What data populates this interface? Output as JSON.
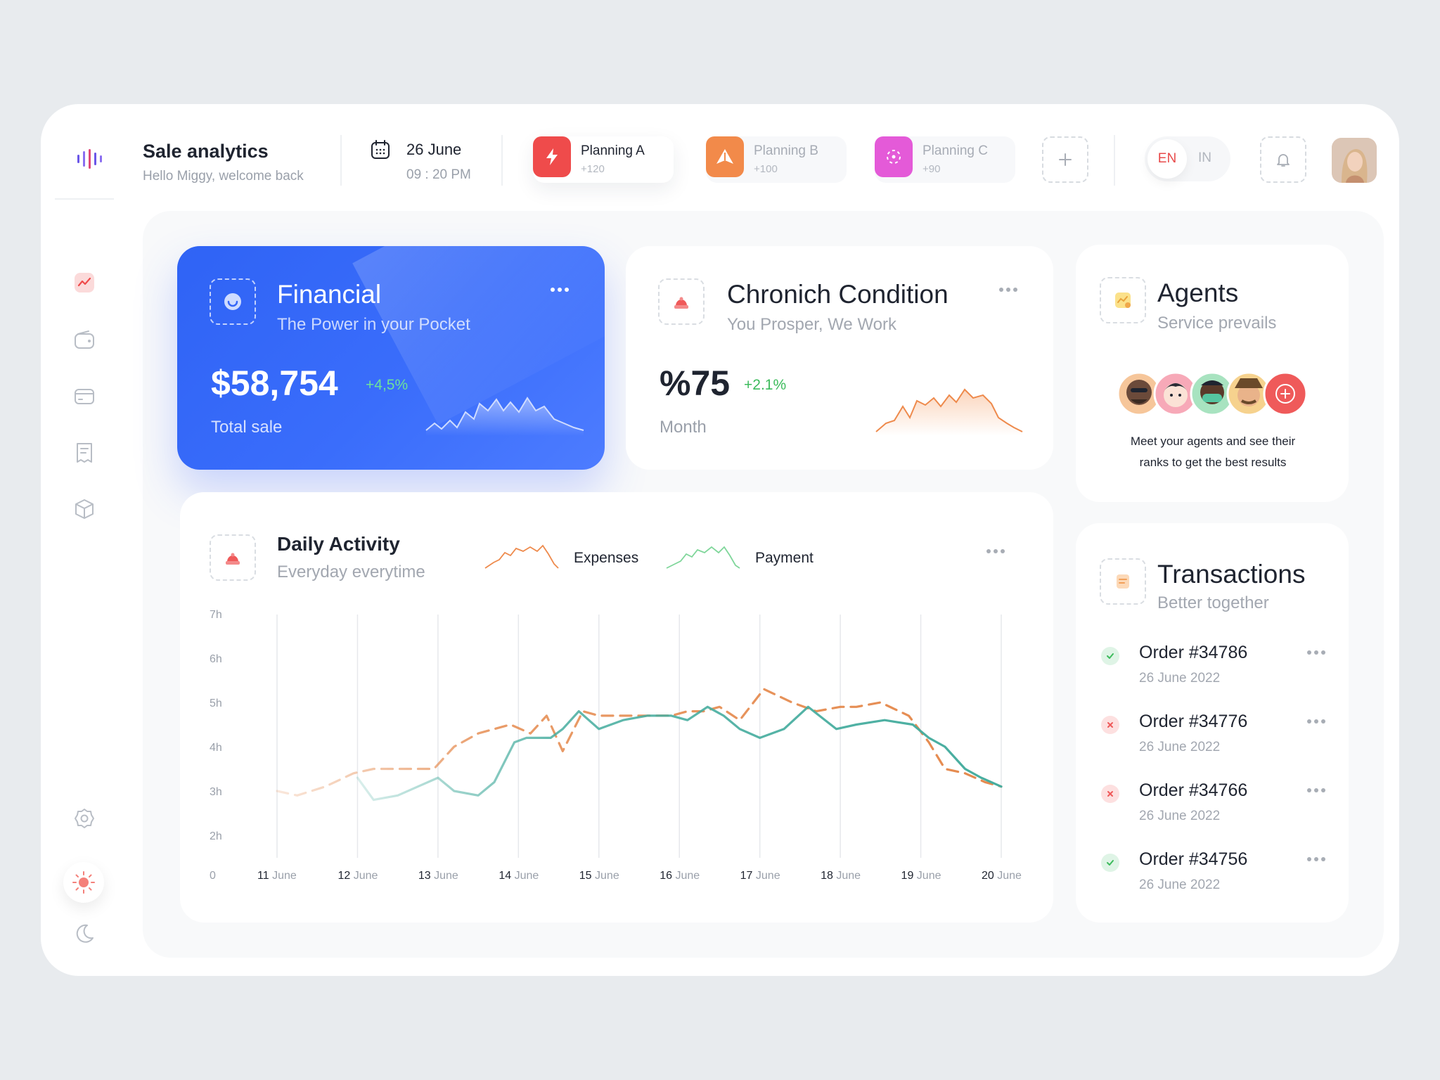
{
  "header": {
    "title": "Sale analytics",
    "subtitle": "Hello Miggy, welcome back",
    "date": "26 June",
    "time": "09 : 20 PM",
    "plans": [
      {
        "name": "Planning A",
        "count": "+120",
        "color": "#ef4b4b",
        "icon": "bolt-icon"
      },
      {
        "name": "Planning B",
        "count": "+100",
        "color": "#f28a4a",
        "icon": "triangle-logo-icon"
      },
      {
        "name": "Planning C",
        "count": "+90",
        "color": "#e45ad8",
        "icon": "scan-icon"
      }
    ],
    "lang_active": "EN",
    "lang_other": "IN"
  },
  "financial": {
    "title": "Financial",
    "subtitle": "The Power in your Pocket",
    "value": "$58,754",
    "delta": "+4,5%",
    "label": "Total sale"
  },
  "chronic": {
    "title": "Chronich Condition",
    "subtitle": "You Prosper, We Work",
    "value": "%75",
    "delta": "+2.1%",
    "label": "Month"
  },
  "agents": {
    "title": "Agents",
    "subtitle": "Service prevails",
    "text_line1": "Meet your agents and see their",
    "text_line2": "ranks to get the best results"
  },
  "daily": {
    "title": "Daily Activity",
    "subtitle": "Everyday everytime",
    "legend_expenses": "Expenses",
    "legend_payment": "Payment"
  },
  "transactions": {
    "title": "Transactions",
    "subtitle": "Better together",
    "items": [
      {
        "order": "Order #34786",
        "date": "26 June 2022",
        "status": "success"
      },
      {
        "order": "Order #34776",
        "date": "26 June 2022",
        "status": "failed"
      },
      {
        "order": "Order #34766",
        "date": "26 June 2022",
        "status": "failed"
      },
      {
        "order": "Order #34756",
        "date": "26 June 2022",
        "status": "success"
      }
    ]
  },
  "colors": {
    "accent_blue": "#3566f8",
    "expenses": "#e58a4e",
    "payment": "#47ad9f",
    "positive": "#3dbb5c",
    "negative": "#ef5a5a"
  },
  "chart_data": {
    "type": "line",
    "y_ticks": [
      "0",
      "2h",
      "3h",
      "4h",
      "5h",
      "6h",
      "7h"
    ],
    "x_ticks": [
      {
        "day": "11",
        "month": "June"
      },
      {
        "day": "12",
        "month": "June"
      },
      {
        "day": "13",
        "month": "June"
      },
      {
        "day": "14",
        "month": "June"
      },
      {
        "day": "15",
        "month": "June"
      },
      {
        "day": "16",
        "month": "June"
      },
      {
        "day": "17",
        "month": "June"
      },
      {
        "day": "18",
        "month": "June"
      },
      {
        "day": "19",
        "month": "June"
      },
      {
        "day": "20",
        "month": "June"
      }
    ],
    "series": [
      {
        "name": "Expenses",
        "style": "dashed",
        "x": [
          11.0,
          11.25,
          11.6,
          11.95,
          12.2,
          12.5,
          12.7,
          12.95,
          13.2,
          13.5,
          13.7,
          13.9,
          14.15,
          14.35,
          14.55,
          14.8,
          15.0,
          15.3,
          15.6,
          15.9,
          16.1,
          16.3,
          16.5,
          16.75,
          17.05,
          17.4,
          17.7,
          18.0,
          18.2,
          18.5,
          18.85,
          19.1,
          19.3,
          19.55,
          19.8,
          20.0
        ],
        "y": [
          3.0,
          2.9,
          3.1,
          3.4,
          3.5,
          3.5,
          3.5,
          3.5,
          4.0,
          4.3,
          4.4,
          4.5,
          4.3,
          4.7,
          3.9,
          4.8,
          4.7,
          4.7,
          4.7,
          4.7,
          4.8,
          4.8,
          4.9,
          4.6,
          5.3,
          5.0,
          4.8,
          4.9,
          4.9,
          5.0,
          4.7,
          4.1,
          3.5,
          3.4,
          3.2,
          3.1
        ]
      },
      {
        "name": "Payment",
        "style": "solid",
        "x": [
          12.0,
          12.2,
          12.5,
          12.75,
          13.0,
          13.2,
          13.5,
          13.7,
          13.95,
          14.1,
          14.25,
          14.4,
          14.55,
          14.75,
          15.0,
          15.3,
          15.6,
          15.9,
          16.1,
          16.35,
          16.55,
          16.75,
          17.0,
          17.3,
          17.6,
          17.95,
          18.2,
          18.55,
          18.9,
          19.1,
          19.3,
          19.55,
          19.75,
          20.0
        ],
        "y": [
          3.3,
          2.8,
          2.9,
          3.1,
          3.3,
          3.0,
          2.9,
          3.2,
          4.1,
          4.2,
          4.2,
          4.2,
          4.4,
          4.8,
          4.4,
          4.6,
          4.7,
          4.7,
          4.6,
          4.9,
          4.7,
          4.4,
          4.2,
          4.4,
          4.9,
          4.4,
          4.5,
          4.6,
          4.5,
          4.2,
          4.0,
          3.5,
          3.3,
          3.1
        ]
      }
    ]
  }
}
